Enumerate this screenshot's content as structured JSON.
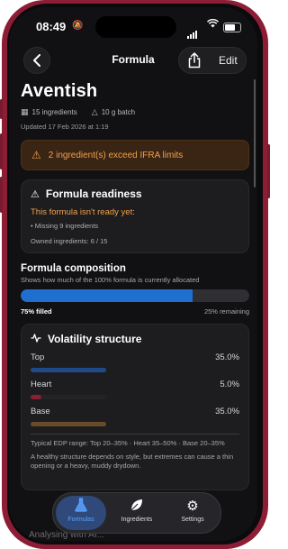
{
  "status": {
    "time": "08:49"
  },
  "nav": {
    "title": "Formula",
    "edit_label": "Edit"
  },
  "formula": {
    "name": "Aventish",
    "ingredients_count": "15 ingredients",
    "batch": "10 g batch",
    "updated": "Updated 17 Feb 2026 at 1:19"
  },
  "warning": {
    "text": "2 ingredient(s) exceed IFRA limits"
  },
  "readiness": {
    "title": "Formula readiness",
    "status": "This formula isn't ready yet:",
    "missing": "• Missing 9 ingredients",
    "owned": "Owned ingredients: 6 / 15"
  },
  "composition": {
    "title": "Formula composition",
    "subtitle": "Shows how much of the 100% formula is currently allocated",
    "filled_fraction": 0.75,
    "filled_label": "75% filled",
    "remaining_label": "25% remaining",
    "fill_color": "#1f6fd1"
  },
  "volatility": {
    "title": "Volatility structure",
    "rows": [
      {
        "label": "Top",
        "value": "35.0%",
        "fraction": 0.35,
        "color": "#1f4a8a"
      },
      {
        "label": "Heart",
        "value": "5.0%",
        "fraction": 0.05,
        "color": "#8a1f36"
      },
      {
        "label": "Base",
        "value": "35.0%",
        "fraction": 0.35,
        "color": "#6b4a2a"
      }
    ],
    "note1": "Typical EDP range: Top 20–35% · Heart 35–50% · Base 20–35%",
    "note2": "A healthy structure depends on style, but extremes can cause a thin opening or a heavy, muddy drydown."
  },
  "tabs": [
    {
      "label": "Formulas",
      "icon": "flask-icon",
      "active": true
    },
    {
      "label": "Ingredients",
      "icon": "leaf-icon",
      "active": false
    },
    {
      "label": "Settings",
      "icon": "gear-icon",
      "active": false
    }
  ],
  "footer": {
    "analysing": "Analysing with AI..."
  },
  "colors": {
    "accent": "#f0a04b",
    "frame": "#8c1d34",
    "active_tab": "#5aa0ff"
  }
}
